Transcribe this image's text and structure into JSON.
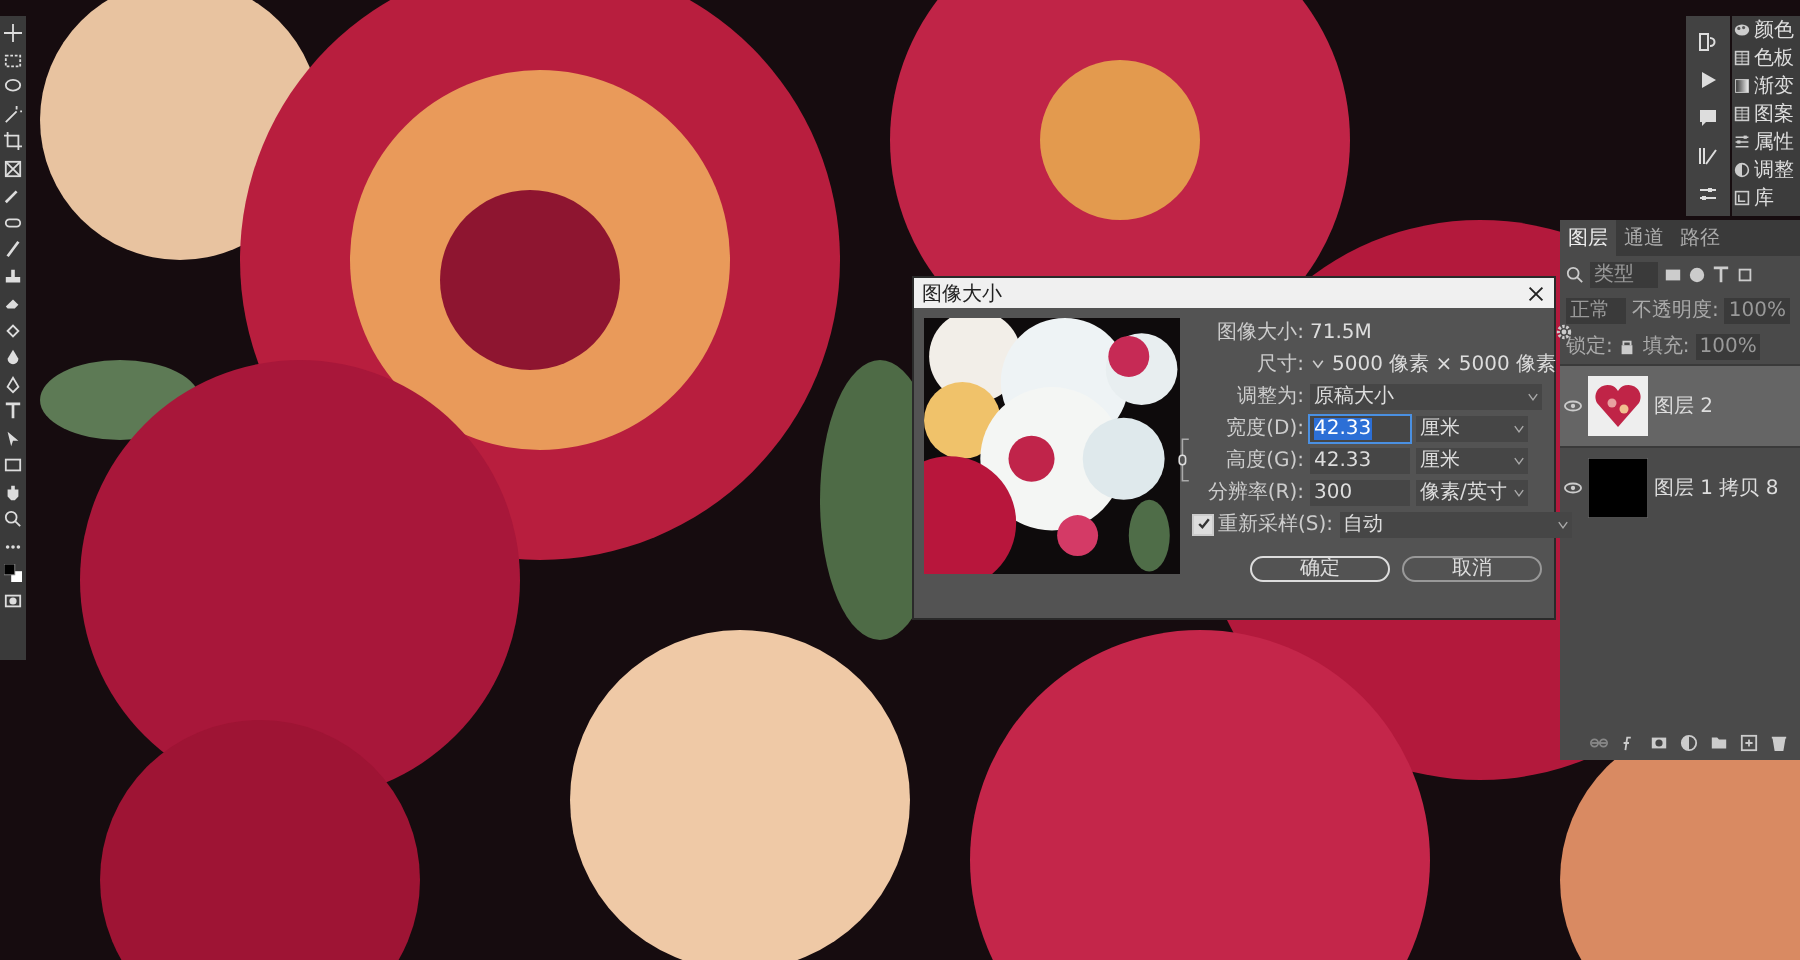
{
  "side_panels": [
    {
      "label": "颜色",
      "kind": "palette"
    },
    {
      "label": "色板",
      "kind": "grid"
    },
    {
      "label": "渐变",
      "kind": "gradient"
    },
    {
      "label": "图案",
      "kind": "grid"
    },
    {
      "label": "属性",
      "kind": "sliders"
    },
    {
      "label": "调整",
      "kind": "circle"
    },
    {
      "label": "库",
      "kind": "library"
    }
  ],
  "layers_panel": {
    "tabs": [
      {
        "label": "图层",
        "selected": true
      },
      {
        "label": "通道",
        "selected": false
      },
      {
        "label": "路径",
        "selected": false
      }
    ],
    "filter": {
      "placeholder": "类型"
    },
    "blend_mode": "正常",
    "opacity_label": "不透明度:",
    "opacity": "100%",
    "lock_label": "锁定:",
    "fill_label": "填充:",
    "fill": "100%",
    "layers": [
      {
        "name": "图层 2",
        "visible": true,
        "selected": true,
        "kind": "heart"
      },
      {
        "name": "图层 1 拷贝 8",
        "visible": true,
        "selected": false,
        "kind": "filled"
      }
    ]
  },
  "dialog": {
    "title": "图像大小",
    "size_label": "图像大小:",
    "size": "71.5M",
    "dims_label": "尺寸:",
    "dims": "5000 像素 × 5000 像素",
    "fit_label": "调整为:",
    "fit": "原稿大小",
    "fields": [
      {
        "label": "宽度(D):",
        "value": "42.33",
        "unit": "厘米",
        "focused": true
      },
      {
        "label": "高度(G):",
        "value": "42.33",
        "unit": "厘米",
        "focused": false
      },
      {
        "label": "分辨率(R):",
        "value": "300",
        "unit": "像素/英寸",
        "focused": false
      }
    ],
    "resample": {
      "label": "重新采样(S):",
      "checked": true,
      "value": "自动"
    },
    "buttons": [
      {
        "label": "确定",
        "kind": "primary"
      },
      {
        "label": "取消",
        "kind": "secondary"
      }
    ]
  }
}
